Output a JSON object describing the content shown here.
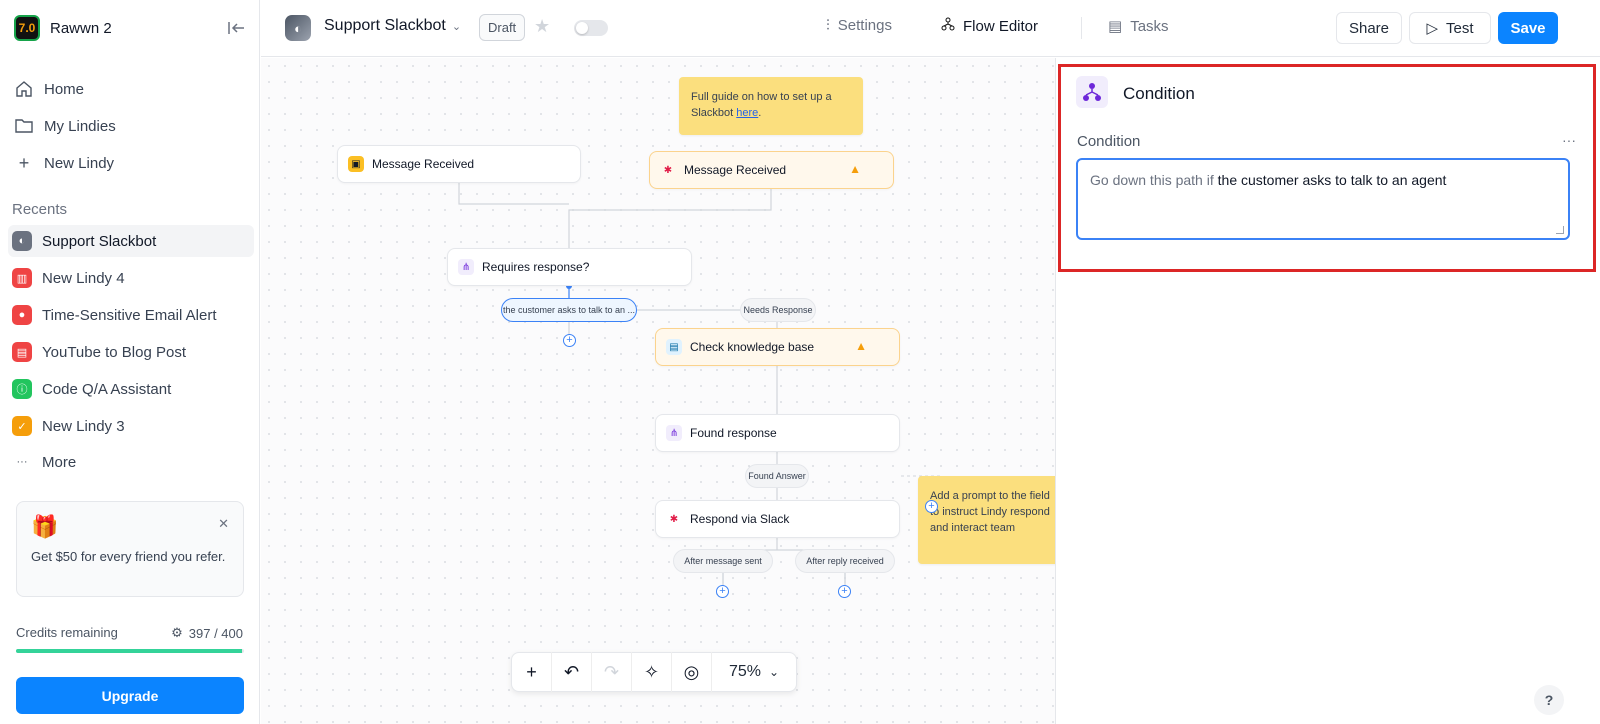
{
  "workspace": {
    "name": "Rawwn 2",
    "logo_text": "7.0"
  },
  "sidebar": {
    "nav": [
      {
        "label": "Home",
        "icon": "home-icon"
      },
      {
        "label": "My Lindies",
        "icon": "folder-icon"
      },
      {
        "label": "New Lindy",
        "icon": "plus-icon"
      }
    ],
    "recents_label": "Recents",
    "recents": [
      {
        "label": "Support Slackbot",
        "color": "#6b7280",
        "active": true
      },
      {
        "label": "New Lindy 4",
        "color": "#ef4444"
      },
      {
        "label": "Time-Sensitive Email Alert",
        "color": "#ef4444"
      },
      {
        "label": "YouTube to Blog Post",
        "color": "#ef4444"
      },
      {
        "label": "Code Q/A Assistant",
        "color": "#22c55e"
      },
      {
        "label": "New Lindy 3",
        "color": "#f59e0b"
      }
    ],
    "more_label": "More",
    "referral": {
      "text": "Get $50 for every friend you refer."
    },
    "credits": {
      "label": "Credits remaining",
      "value": "397 / 400",
      "fraction": 0.9925
    },
    "upgrade_label": "Upgrade"
  },
  "header": {
    "agent_name": "Support Slackbot",
    "status_badge": "Draft",
    "tabs": {
      "settings": "Settings",
      "flow_editor": "Flow Editor",
      "tasks": "Tasks"
    },
    "share_label": "Share",
    "test_label": "Test",
    "save_label": "Save"
  },
  "canvas": {
    "note_top_text": "Full guide on how to set up a Slackbot ",
    "note_top_link": "here",
    "note_top_end": ".",
    "note_right_text": "Add a prompt to the field to instruct Lindy respond and interact team",
    "nodes": {
      "msg_received_1": "Message Received",
      "msg_received_2": "Message Received",
      "requires_response": "Requires response?",
      "check_kb": "Check knowledge base",
      "found_response": "Found response",
      "respond_slack": "Respond via Slack"
    },
    "pills": {
      "customer_path": "the customer asks to talk to an ...",
      "needs_response": "Needs Response",
      "found_answer": "Found Answer",
      "after_sent": "After message sent",
      "after_reply": "After reply received"
    },
    "zoom": "75%"
  },
  "panel": {
    "title": "Condition",
    "field_label": "Condition",
    "prefix": "Go down this path if",
    "value": " the customer asks to talk to an agent"
  },
  "help_label": "?"
}
